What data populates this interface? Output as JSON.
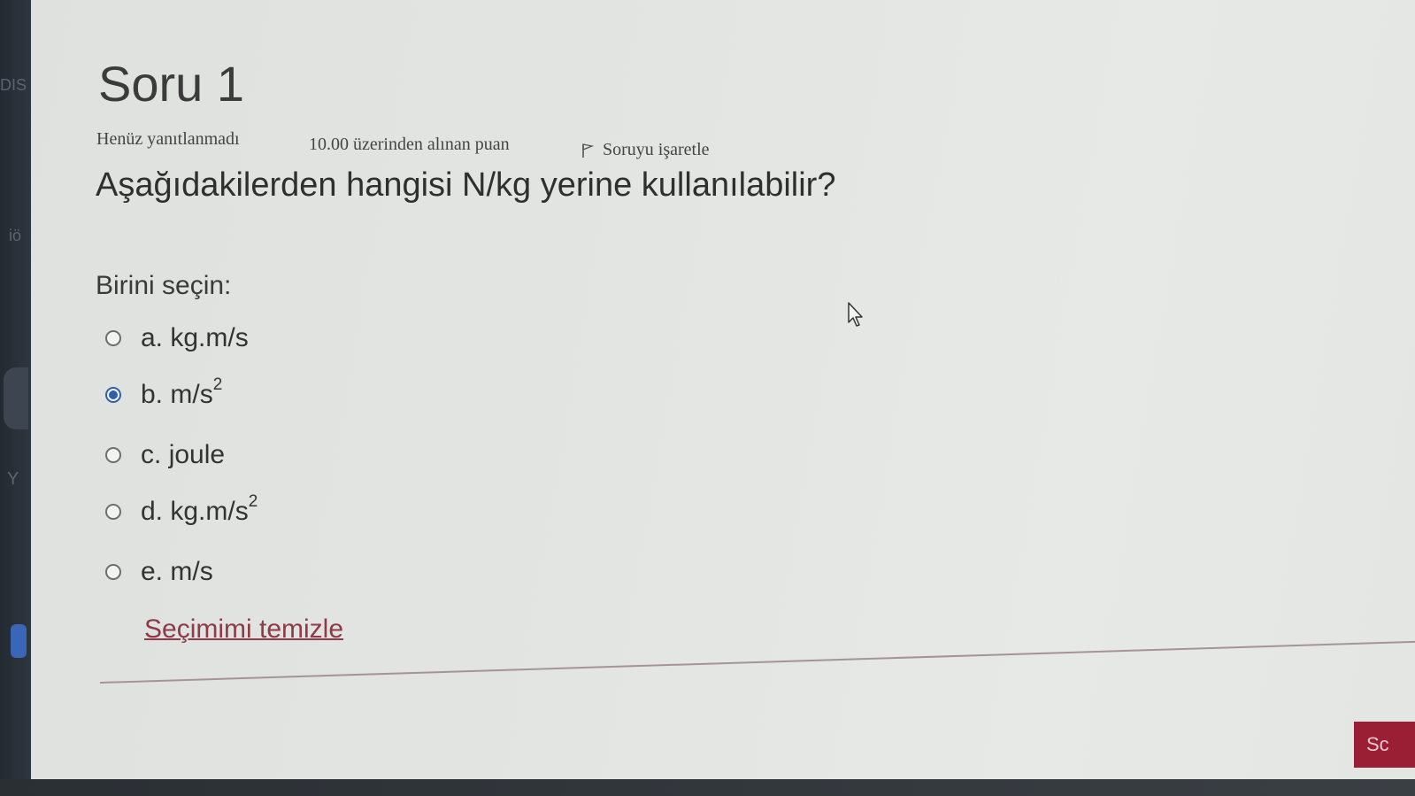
{
  "sidebar": {
    "fragments": [
      "DIS",
      "iö",
      "Y"
    ]
  },
  "question": {
    "title": "Soru 1",
    "status": "Henüz yanıtlanmadı",
    "grade": "10.00 üzerinden alınan puan",
    "flag_label": "Soruyu işaretle",
    "text": "Aşağıdakilerden hangisi N/kg yerine kullanılabilir?",
    "prompt": "Birini seçin:",
    "options": [
      {
        "letter": "a.",
        "text": "kg.m/s",
        "sup": "",
        "selected": false
      },
      {
        "letter": "b.",
        "text": "m/s",
        "sup": "2",
        "selected": true
      },
      {
        "letter": "c.",
        "text": "joule",
        "sup": "",
        "selected": false
      },
      {
        "letter": "d.",
        "text": "kg.m/s",
        "sup": "2",
        "selected": false
      },
      {
        "letter": "e.",
        "text": "m/s",
        "sup": "",
        "selected": false
      }
    ],
    "clear_label": "Seçimimi temizle"
  },
  "navigation": {
    "next_label": "Sc"
  },
  "colors": {
    "accent": "#2f5fb0",
    "link": "#8e3a48",
    "button": "#9b1f34"
  }
}
